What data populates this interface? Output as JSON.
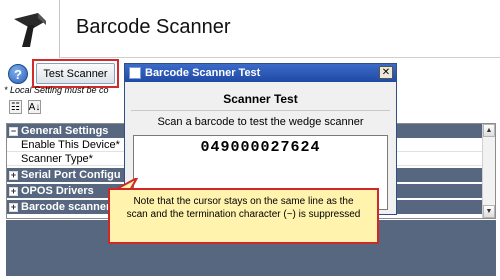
{
  "header": {
    "title": "Barcode Scanner",
    "icon": "barcode-scanner-icon"
  },
  "toolbar": {
    "help_glyph": "?",
    "test_button_label": "Test Scanner",
    "local_note": "* Local Setting must be co",
    "highlight_color": "#d22b2b"
  },
  "property_grid": {
    "rows": [
      {
        "kind": "category",
        "toggle": "⊟",
        "label": "General Settings"
      },
      {
        "kind": "property",
        "label": "Enable This Device*"
      },
      {
        "kind": "property",
        "label": "Scanner Type*"
      },
      {
        "kind": "category",
        "toggle": "⊞",
        "label": "Serial Port Configu"
      },
      {
        "kind": "category",
        "toggle": "⊞",
        "label": "OPOS Drivers"
      },
      {
        "kind": "category",
        "toggle": "⊞",
        "label": "Barcode scanner"
      }
    ],
    "category_color": "#56677f"
  },
  "dialog": {
    "title": "Barcode Scanner Test",
    "close_glyph": "✕",
    "heading": "Scanner Test",
    "instruction": "Scan a barcode to test the wedge scanner",
    "scan_value": "049000027624",
    "titlebar_color": "#1f4aa4"
  },
  "callout": {
    "text": "Note that the cursor stays on the same line as the scan and the termination character (~) is suppressed",
    "background": "#fff3ad",
    "border_color": "#d02828"
  }
}
